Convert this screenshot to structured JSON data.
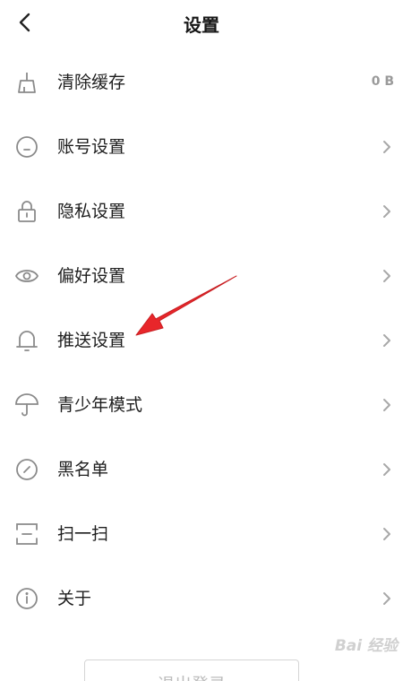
{
  "header": {
    "title": "设置",
    "back_icon": "chevron-left-icon"
  },
  "settings": {
    "items": [
      {
        "label": "清除缓存",
        "icon": "broom-icon",
        "value": "0 B"
      },
      {
        "label": "账号设置",
        "icon": "account-icon"
      },
      {
        "label": "隐私设置",
        "icon": "lock-icon"
      },
      {
        "label": "偏好设置",
        "icon": "eye-icon"
      },
      {
        "label": "推送设置",
        "icon": "bell-icon"
      },
      {
        "label": "青少年模式",
        "icon": "umbrella-icon"
      },
      {
        "label": "黑名单",
        "icon": "block-icon"
      },
      {
        "label": "扫一扫",
        "icon": "scan-icon"
      },
      {
        "label": "关于",
        "icon": "info-icon"
      }
    ]
  },
  "footer": {
    "logout_label": "退出登录"
  },
  "annotation": {
    "arrow_color": "#e8262a"
  },
  "watermark": {
    "text": "Bai 经验"
  },
  "colors": {
    "text": "#1e1e1e",
    "icon": "#8a8a8a",
    "muted": "#9a9a9a"
  }
}
